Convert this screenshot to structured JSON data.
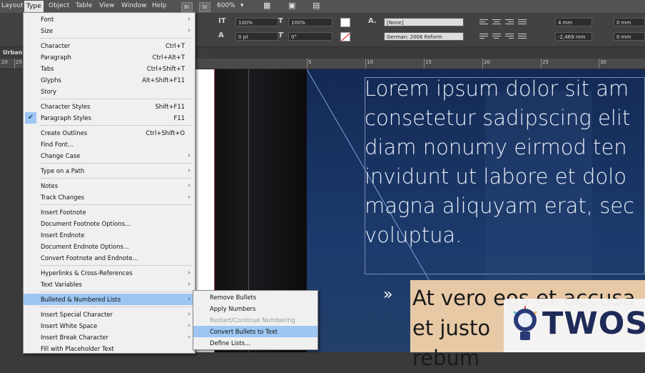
{
  "menubar": {
    "items": [
      "Layout",
      "Type",
      "Object",
      "Table",
      "View",
      "Window",
      "Help"
    ],
    "badges": [
      "Br",
      "St"
    ],
    "zoom": "600%"
  },
  "control_panel": {
    "leading": "100%",
    "tracking": "0 pt",
    "skew": "0°",
    "scale": "100%",
    "char_style": "[None]",
    "language": "German: 2006 Reform",
    "indent_left": "4 mm",
    "indent_right": "0 mm",
    "indent_first": "-2,469 mm",
    "space_after": "0 mm",
    "char_label": "A."
  },
  "doc_tab": "Urban I",
  "ruler": [
    "20",
    "25",
    "5",
    "10",
    "15",
    "20",
    "25",
    "30"
  ],
  "type_menu": [
    {
      "label": "Font",
      "key": "",
      "sub": true
    },
    {
      "label": "Size",
      "key": "",
      "sub": true
    },
    {
      "sep": true
    },
    {
      "label": "Character",
      "key": "Ctrl+T"
    },
    {
      "label": "Paragraph",
      "key": "Ctrl+Alt+T"
    },
    {
      "label": "Tabs",
      "key": "Ctrl+Shift+T"
    },
    {
      "label": "Glyphs",
      "key": "Alt+Shift+F11"
    },
    {
      "label": "Story",
      "key": ""
    },
    {
      "sep": true
    },
    {
      "label": "Character Styles",
      "key": "Shift+F11"
    },
    {
      "label": "Paragraph Styles",
      "key": "F11",
      "checked": true
    },
    {
      "sep": true
    },
    {
      "label": "Create Outlines",
      "key": "Ctrl+Shift+O"
    },
    {
      "label": "Find Font...",
      "key": ""
    },
    {
      "label": "Change Case",
      "key": "",
      "sub": true
    },
    {
      "sep": true
    },
    {
      "label": "Type on a Path",
      "key": "",
      "sub": true
    },
    {
      "sep": true
    },
    {
      "label": "Notes",
      "key": "",
      "sub": true
    },
    {
      "label": "Track Changes",
      "key": "",
      "sub": true
    },
    {
      "sep": true
    },
    {
      "label": "Insert Footnote",
      "key": ""
    },
    {
      "label": "Document Footnote Options...",
      "key": ""
    },
    {
      "label": "Insert Endnote",
      "key": ""
    },
    {
      "label": "Document Endnote Options...",
      "key": ""
    },
    {
      "label": "Convert Footnote and Endnote...",
      "key": ""
    },
    {
      "sep": true
    },
    {
      "label": "Hyperlinks & Cross-References",
      "key": "",
      "sub": true
    },
    {
      "label": "Text Variables",
      "key": "",
      "sub": true
    },
    {
      "sep": true
    },
    {
      "label": "Bulleted & Numbered Lists",
      "key": "",
      "sub": true,
      "highlight": true
    },
    {
      "sep": true
    },
    {
      "label": "Insert Special Character",
      "key": "",
      "sub": true
    },
    {
      "label": "Insert White Space",
      "key": "",
      "sub": true
    },
    {
      "label": "Insert Break Character",
      "key": "",
      "sub": true
    },
    {
      "label": "Fill with Placeholder Text",
      "key": ""
    }
  ],
  "submenu": [
    {
      "label": "Remove Bullets"
    },
    {
      "label": "Apply Numbers"
    },
    {
      "label": "Restart/Continue Numbering",
      "disabled": true
    },
    {
      "label": "Convert Bullets to Text",
      "highlight": true
    },
    {
      "label": "Define Lists..."
    }
  ],
  "canvas": {
    "body_text": "Lorem ipsum dolor sit am\nconsetetur sadipscing elit\ndiam nonumy eirmod ten\ninvidunt ut labore et dolo\nmagna aliquyam erat, sec\nvoluptua.",
    "bullet_char": "»",
    "bullet_text": "At vero eos et accusa\net justo\nrebum"
  },
  "watermark": "TWOS"
}
